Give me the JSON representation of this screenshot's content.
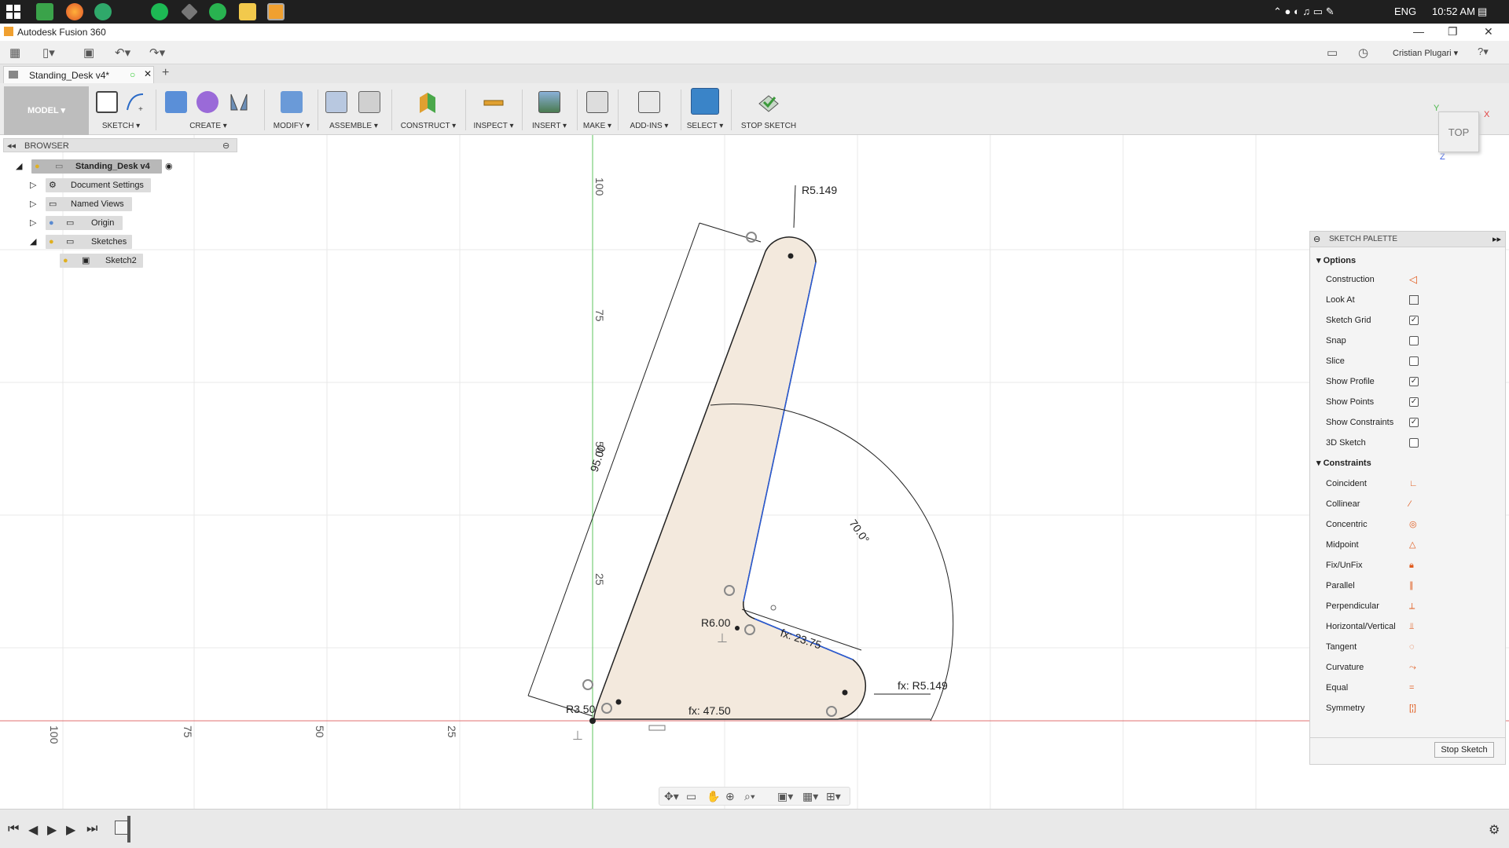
{
  "taskbar": {
    "clock": "10:52 AM",
    "language": "ENG"
  },
  "window": {
    "title": "Autodesk Fusion 360"
  },
  "appbar": {
    "user_name": "Cristian Plugari ▾",
    "help": "?"
  },
  "tabs": [
    {
      "label": "Standing_Desk v4*"
    }
  ],
  "ribbon": {
    "workspace": "MODEL ▾",
    "groups": [
      {
        "label": "SKETCH ▾"
      },
      {
        "label": "CREATE ▾"
      },
      {
        "label": "MODIFY ▾"
      },
      {
        "label": "ASSEMBLE ▾"
      },
      {
        "label": "CONSTRUCT ▾"
      },
      {
        "label": "INSPECT ▾"
      },
      {
        "label": "INSERT ▾"
      },
      {
        "label": "MAKE ▾"
      },
      {
        "label": "ADD-INS ▾"
      },
      {
        "label": "SELECT ▾"
      },
      {
        "label": "STOP SKETCH"
      }
    ]
  },
  "browser": {
    "header": "BROWSER",
    "root": "Standing_Desk v4",
    "items": [
      {
        "label": "Document Settings"
      },
      {
        "label": "Named Views"
      },
      {
        "label": "Origin"
      },
      {
        "label": "Sketches"
      },
      {
        "label": "Sketch2"
      }
    ]
  },
  "viewcube": {
    "face": "TOP",
    "axes": {
      "x": "X",
      "y": "Y",
      "z": "Z"
    }
  },
  "sketch": {
    "dimensions": {
      "r_top": "R5.149",
      "length": "95.00",
      "angle": "70.0°",
      "fillet": "R6.00",
      "inner": "fx: 23.75",
      "r_right": "fx: R5.149",
      "r_left": "R3.50",
      "base": "fx: 47.50"
    },
    "v_ruler": [
      "100",
      "75",
      "50",
      "25"
    ],
    "h_ruler": [
      "100",
      "75",
      "50",
      "25"
    ]
  },
  "palette": {
    "title": "SKETCH PALETTE",
    "options_header": "Options",
    "options": [
      {
        "label": "Construction",
        "icon": "construction-icon"
      },
      {
        "label": "Look At",
        "icon": "look-at-icon"
      },
      {
        "label": "Sketch Grid",
        "checked": true
      },
      {
        "label": "Snap",
        "checked": false
      },
      {
        "label": "Slice",
        "checked": false
      },
      {
        "label": "Show Profile",
        "checked": true
      },
      {
        "label": "Show Points",
        "checked": true
      },
      {
        "label": "Show Constraints",
        "checked": true
      },
      {
        "label": "3D Sketch",
        "checked": false
      }
    ],
    "constraints_header": "Constraints",
    "constraints": [
      {
        "label": "Coincident",
        "icon": "coincident-icon"
      },
      {
        "label": "Collinear",
        "icon": "collinear-icon"
      },
      {
        "label": "Concentric",
        "icon": "concentric-icon"
      },
      {
        "label": "Midpoint",
        "icon": "midpoint-icon"
      },
      {
        "label": "Fix/UnFix",
        "icon": "fix-icon"
      },
      {
        "label": "Parallel",
        "icon": "parallel-icon"
      },
      {
        "label": "Perpendicular",
        "icon": "perpendicular-icon"
      },
      {
        "label": "Horizontal/Vertical",
        "icon": "horizontal-vertical-icon"
      },
      {
        "label": "Tangent",
        "icon": "tangent-icon"
      },
      {
        "label": "Curvature",
        "icon": "curvature-icon"
      },
      {
        "label": "Equal",
        "icon": "equal-icon"
      },
      {
        "label": "Symmetry",
        "icon": "symmetry-icon"
      }
    ],
    "stop_button": "Stop Sketch"
  },
  "colors": {
    "accent": "#e05a1c",
    "profile_fill": "#f3e9dd",
    "blue_line": "#2a5bd7",
    "x_axis": "#e07070",
    "y_axis": "#5ec45e"
  }
}
